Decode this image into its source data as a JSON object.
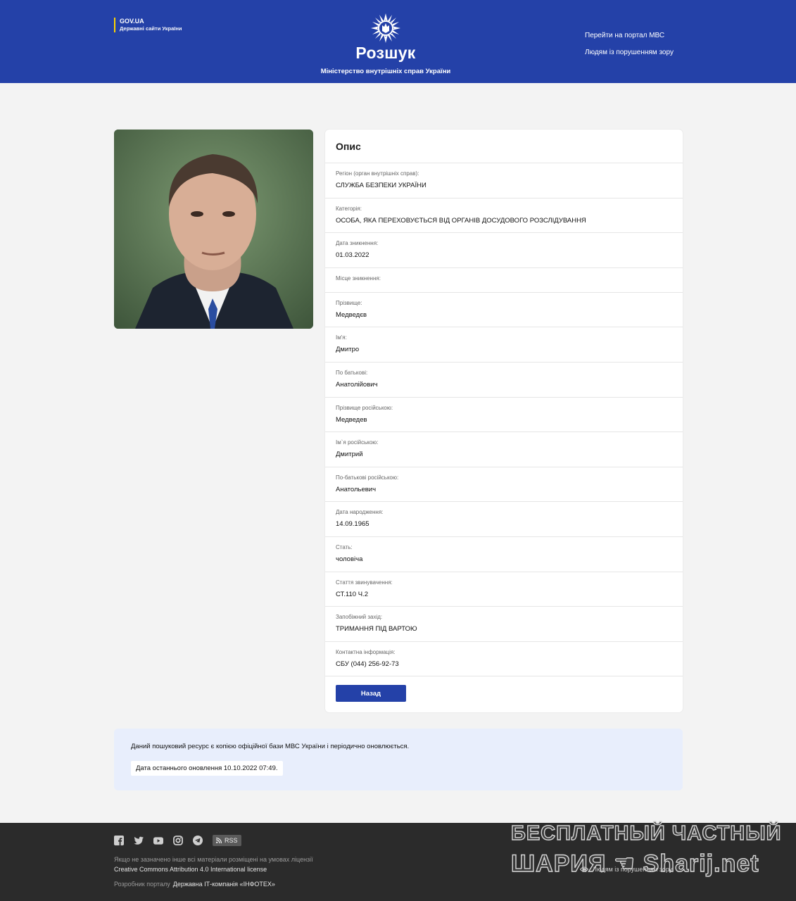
{
  "header": {
    "gov_title": "GOV.UA",
    "gov_subtitle": "Державні сайти України",
    "site_title": "Розшук",
    "site_subtitle": "Міністерство внутрішніх справ України",
    "links": [
      "Перейти на портал МВС",
      "Людям із порушенням зору"
    ],
    "bg_color": "#2441a8"
  },
  "card": {
    "title": "Опис",
    "rows": [
      {
        "label": "Регіон (орган внутрішніх справ):",
        "value": "СЛУЖБА БЕЗПЕКИ УКРАЇНИ"
      },
      {
        "label": "Категорія:",
        "value": "ОСОБА, ЯКА ПЕРЕХОВУЄТЬСЯ ВІД ОРГАНІВ ДОСУДОВОГО РОЗСЛІДУВАННЯ"
      },
      {
        "label": "Дата зникнення:",
        "value": "01.03.2022"
      },
      {
        "label": "Місце зникнення:",
        "value": ""
      },
      {
        "label": "Прізвище:",
        "value": "Медведєв"
      },
      {
        "label": "Ім'я:",
        "value": "Дмитро"
      },
      {
        "label": "По батькові:",
        "value": "Анатолійович"
      },
      {
        "label": "Прізвище російською:",
        "value": "Медведев"
      },
      {
        "label": "Ім`я російською:",
        "value": "Дмитрий"
      },
      {
        "label": "По-батькові російською:",
        "value": "Анатольевич"
      },
      {
        "label": "Дата народження:",
        "value": "14.09.1965"
      },
      {
        "label": "Стать:",
        "value": "чоловіча"
      },
      {
        "label": "Стаття звинувачення:",
        "value": "СТ.110 Ч.2"
      },
      {
        "label": "Запобіжний захід:",
        "value": "ТРИМАННЯ ПІД ВАРТОЮ"
      },
      {
        "label": "Контактна інформація:",
        "value": "СБУ (044) 256-92-73"
      }
    ],
    "back_label": "Назад"
  },
  "info": {
    "message": "Даний пошуковий ресурс є копією офіційної бази МВС України і періодично оновлюється.",
    "updated": "Дата останнього оновлення 10.10.2022 07:49."
  },
  "footer": {
    "social_icons": [
      "facebook-icon",
      "twitter-icon",
      "youtube-icon",
      "instagram-icon",
      "telegram-icon"
    ],
    "rss_label": "RSS",
    "license_line1": "Якщо не зазначено інше всі матеріали розміщені на умовах ліцензії",
    "license_line2": "Creative Commons Attribution 4.0 International license",
    "dev_label": "Розробник порталу",
    "dev_name": "Державна ІТ-компанія «ІНФОТЕХ»",
    "accessibility_link": "Людям із порушенням зору"
  },
  "watermark": {
    "line1": "БЕСПЛАТНЫЙ ЧАСТНЫЙ",
    "line2": "ШАРИЯ ☚ Sharij.net"
  }
}
